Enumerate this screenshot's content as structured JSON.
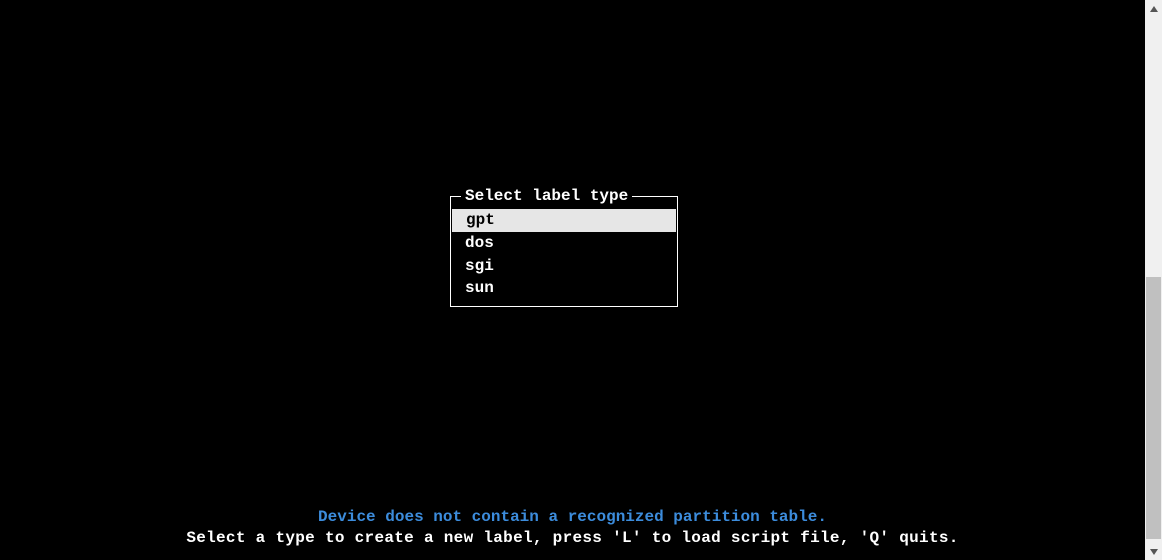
{
  "dialog": {
    "title": "Select label type",
    "items": [
      "gpt",
      "dos",
      "sgi",
      "sun"
    ],
    "selected_index": 0
  },
  "status": {
    "line1": "Device does not contain a recognized partition table.",
    "line2": "Select a type to create a new label, press 'L' to load script file, 'Q' quits."
  }
}
